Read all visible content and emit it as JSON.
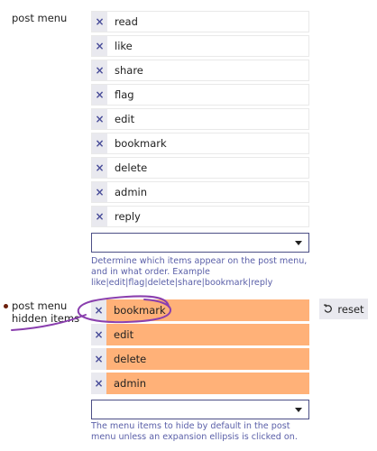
{
  "post_menu": {
    "label": "post menu",
    "items": [
      {
        "value": "read"
      },
      {
        "value": "like"
      },
      {
        "value": "share"
      },
      {
        "value": "flag"
      },
      {
        "value": "edit"
      },
      {
        "value": "bookmark"
      },
      {
        "value": "delete"
      },
      {
        "value": "admin"
      },
      {
        "value": "reply"
      }
    ],
    "remove_glyph": "×",
    "help": "Determine which items appear on the post menu, and in what order. Example like|edit|flag|delete|share|bookmark|reply"
  },
  "post_menu_hidden_items": {
    "label": "post menu hidden items",
    "items": [
      {
        "value": "bookmark"
      },
      {
        "value": "edit"
      },
      {
        "value": "delete"
      },
      {
        "value": "admin"
      }
    ],
    "remove_glyph": "×",
    "reset_label": "reset",
    "help": "The menu items to hide by default in the post menu unless an expansion ellipsis is clicked on.",
    "highlight_color": "#ffb178"
  },
  "colors": {
    "remove_icon": "#4a4e9a",
    "help_text": "#5a5fa8",
    "changed_indicator": "#6b1f0c",
    "annotation": "#8a3fae"
  }
}
